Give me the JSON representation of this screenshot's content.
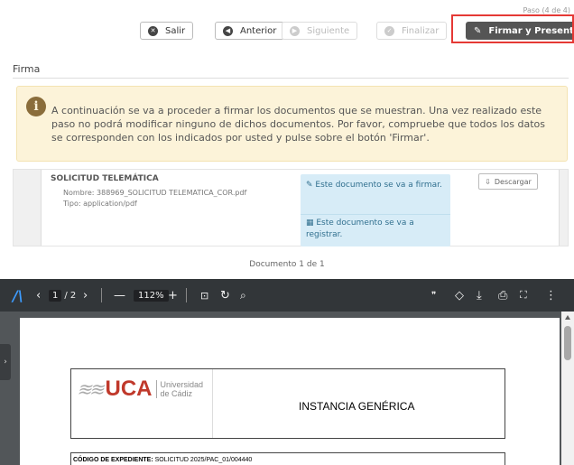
{
  "step": "Paso (4 de 4)",
  "toolbar": {
    "exit_label": "Salir",
    "prev_label": "Anterior",
    "next_label": "Siguiente",
    "finish_label": "Finalizar",
    "sign_label": "Firmar y Presentar"
  },
  "section_title": "Firma",
  "alert_text": "A continuación se va a proceder a firmar los documentos que se muestran. Una vez realizado este paso no podrá modificar ninguno de dichos documentos. Por favor, compruebe que todos los datos se corresponden con los indicados por usted y pulse sobre el botón 'Firmar'.",
  "document": {
    "title": "SOLICITUD TELEMÁTICA",
    "name": "Nombre: 388969_SOLICITUD TELEMATICA_COR.pdf",
    "type": "Tipo: application/pdf",
    "info_sign": "Este documento se va a firmar.",
    "info_register": "Este documento se va a registrar.",
    "download_label": "Descargar"
  },
  "doc_count": "Documento 1 de 1",
  "viewer": {
    "page_current": "1",
    "page_total": "/ 2",
    "zoom": "112%"
  },
  "pdf": {
    "logo_text": "UCA",
    "logo_sub_1": "Universidad",
    "logo_sub_2": "de Cádiz",
    "doc_heading": "INSTANCIA GENÉRICA",
    "exp_label": "CÓDIGO DE EXPEDIENTE:",
    "exp_value": "SOLICITUD 2025/PAC_01/004440"
  },
  "colors": {
    "primary_button": "#555555",
    "highlight": "#e53935",
    "alert_bg": "#fcf3d9",
    "info_bg": "#d7ecf7",
    "viewer_bar": "#323639",
    "uca_red": "#c0392b"
  },
  "icons": [
    "exit-icon",
    "prev-icon",
    "next-icon",
    "finish-icon",
    "edit-icon",
    "info-icon",
    "download-icon",
    "pdf-logo-icon",
    "search-icon",
    "print-icon",
    "fullscreen-icon"
  ]
}
